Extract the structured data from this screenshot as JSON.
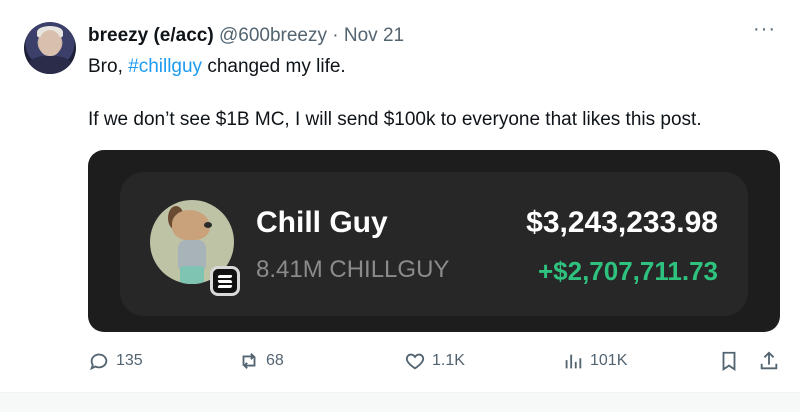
{
  "author": {
    "display_name": "breezy (e/acc)",
    "handle": "@600breezy",
    "separator": "·",
    "date": "Nov 21",
    "more_label": "···"
  },
  "tweet": {
    "line1_prefix": "Bro, ",
    "hashtag": "#chillguy",
    "line1_suffix": " changed my life.",
    "line2": "If we don’t see $1B MC, I will send $100k to everyone that likes this post."
  },
  "card": {
    "token_name": "Chill Guy",
    "token_amount": "8.41M CHILLGUY",
    "value": "$3,243,233.98",
    "pnl": "+$2,707,711.73",
    "chain_icon": "solana-icon",
    "colors": {
      "card_bg": "#1d1d1d",
      "inner_bg": "#272727",
      "pnl_green": "#2ec27e",
      "muted_text": "#8b8b8b"
    }
  },
  "actions": {
    "replies": "135",
    "reposts": "68",
    "likes": "1.1K",
    "views": "101K"
  },
  "colors": {
    "hashtag": "#1d9bf0",
    "secondary_text": "#536471"
  }
}
